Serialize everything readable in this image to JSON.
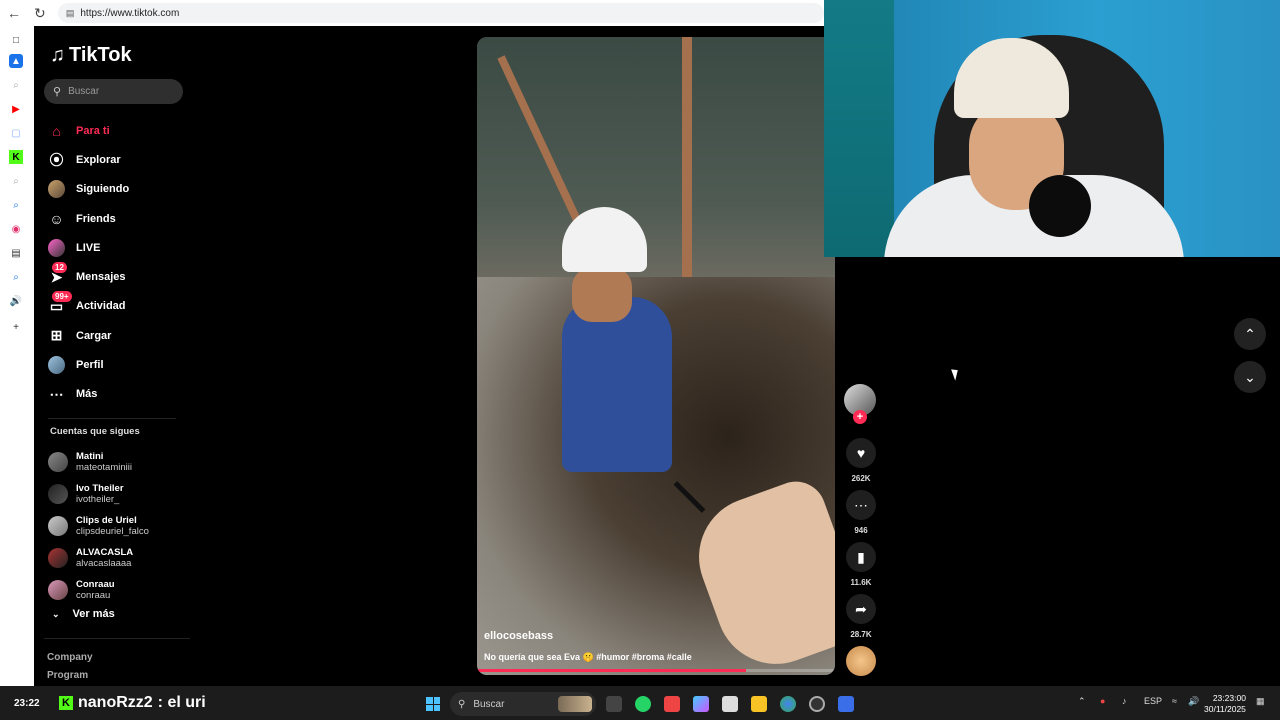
{
  "browser": {
    "url": "https://www.tiktok.com",
    "back_icon": "arrow-left-icon",
    "reload_icon": "reload-icon"
  },
  "sidebar": {
    "logo": "TikTok",
    "search_placeholder": "Buscar",
    "nav": [
      {
        "label": "Para ti",
        "icon": "home-icon",
        "active": true
      },
      {
        "label": "Explorar",
        "icon": "compass-icon"
      },
      {
        "label": "Siguiendo",
        "icon": "avatar-icon"
      },
      {
        "label": "Friends",
        "icon": "friends-icon"
      },
      {
        "label": "LIVE",
        "icon": "live-icon"
      },
      {
        "label": "Mensajes",
        "icon": "messages-icon",
        "badge": "12"
      },
      {
        "label": "Actividad",
        "icon": "activity-icon",
        "badge": "99+"
      },
      {
        "label": "Cargar",
        "icon": "upload-icon"
      },
      {
        "label": "Perfil",
        "icon": "profile-icon"
      },
      {
        "label": "Más",
        "icon": "more-icon"
      }
    ],
    "following_title": "Cuentas que sigues",
    "following": [
      {
        "name": "Matini",
        "handle": "mateotaminiii"
      },
      {
        "name": "Ivo Theiler",
        "handle": "ivotheiler_"
      },
      {
        "name": "Clips de Uriel",
        "handle": "clipsdeuriel_falco"
      },
      {
        "name": "ALVACASLA",
        "handle": "alvacaslaaaa"
      },
      {
        "name": "Conraau",
        "handle": "conraau"
      }
    ],
    "see_more": "Ver más",
    "footer": [
      "Company",
      "Program"
    ]
  },
  "video": {
    "username": "ellocosebass",
    "caption": "No quería que sea Eva 🤫 #humor #broma #calle",
    "progress": 0.75
  },
  "actions": [
    {
      "icon": "heart-icon",
      "count": "262K"
    },
    {
      "icon": "comment-icon",
      "count": "946"
    },
    {
      "icon": "bookmark-icon",
      "count": "11.6K"
    },
    {
      "icon": "share-icon",
      "count": "28.7K"
    }
  ],
  "taskbar": {
    "weather": "23:22",
    "chat_user": "nanoRzz2",
    "chat_message": ": el uri",
    "search_placeholder": "Buscar",
    "language": "ESP",
    "time": "23:23:00",
    "date": "30/11/2025"
  },
  "colors": {
    "accent": "#fe2c55",
    "kick": "#53fc18"
  }
}
